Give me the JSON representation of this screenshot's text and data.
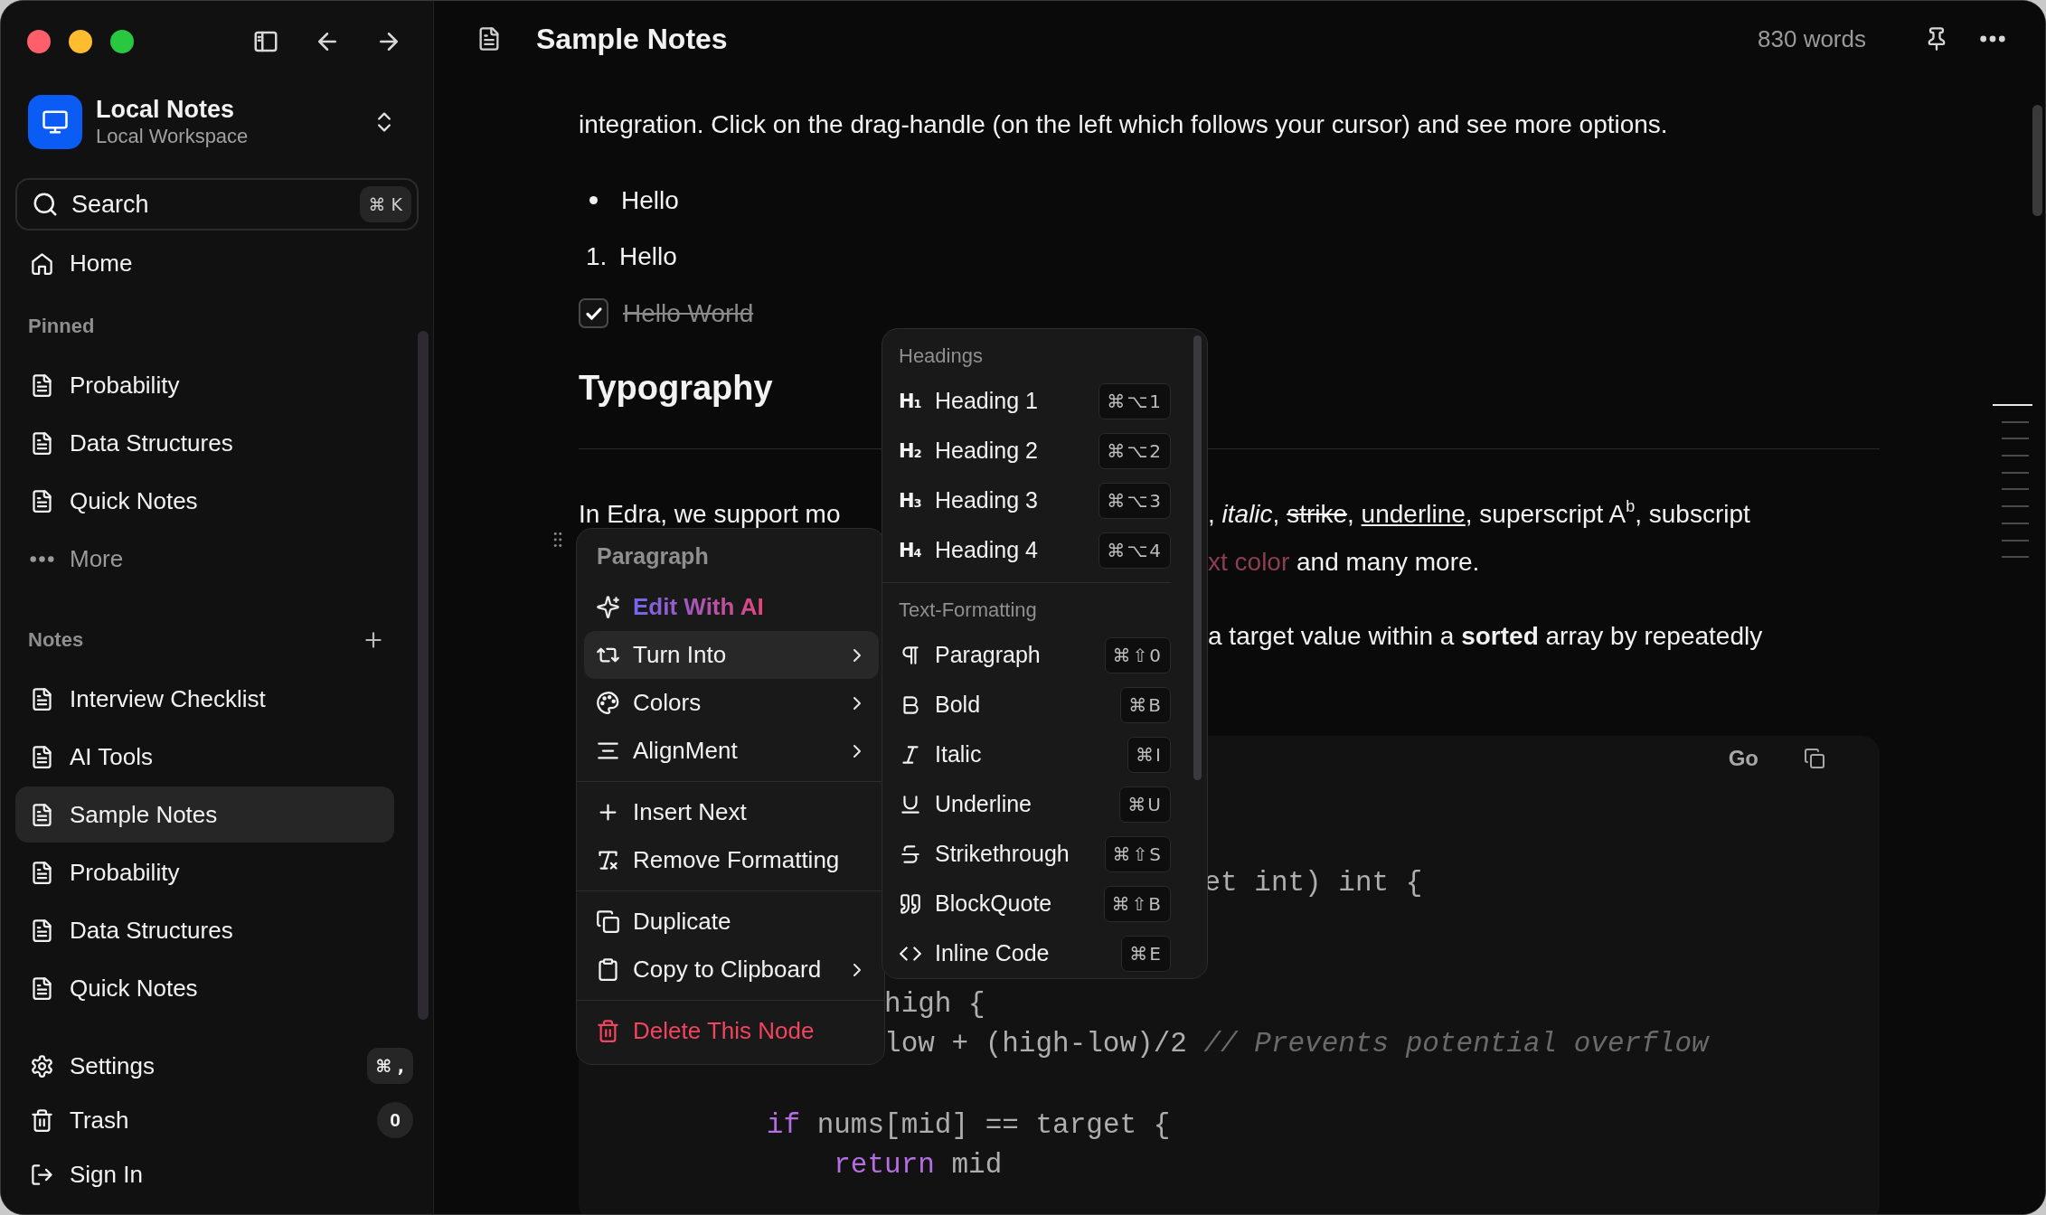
{
  "window": {
    "title": "Sample Notes",
    "word_count": "830 words"
  },
  "sidebar": {
    "workspace": {
      "name": "Local Notes",
      "subtitle": "Local Workspace"
    },
    "search": {
      "label": "Search",
      "shortcut": "⌘ K"
    },
    "home": "Home",
    "pinned": {
      "title": "Pinned",
      "more": "More",
      "items": [
        {
          "label": "Probability",
          "selected": false
        },
        {
          "label": "Data Structures",
          "selected": false
        },
        {
          "label": "Quick Notes",
          "selected": false
        }
      ]
    },
    "notes": {
      "title": "Notes",
      "items": [
        {
          "label": "Interview Checklist",
          "selected": false
        },
        {
          "label": "AI Tools",
          "selected": false
        },
        {
          "label": "Sample Notes",
          "selected": true
        },
        {
          "label": "Probability",
          "selected": false
        },
        {
          "label": "Data Structures",
          "selected": false
        },
        {
          "label": "Quick Notes",
          "selected": false
        }
      ]
    },
    "footer": [
      {
        "kind": "settings",
        "label": "Settings",
        "badge": "⌘ ,"
      },
      {
        "kind": "trash",
        "label": "Trash",
        "badge": "0"
      },
      {
        "kind": "sign_in",
        "label": "Sign In"
      }
    ]
  },
  "document": {
    "intro": [
      "integration. Click on the drag-handle (on the left which follows your cursor) and see more options."
    ],
    "bullet_item": "Hello",
    "numbered_item": {
      "marker": "1.",
      "label": "Hello"
    },
    "task": {
      "label": "Hello World",
      "checked": true
    },
    "heading": "Typography",
    "paragraph_lines": [
      {
        "left": "In Edra, we support mo",
        "right": [
          {
            "kind": "plain",
            "text": ", "
          },
          {
            "kind": "italic",
            "text": "italic"
          },
          {
            "kind": "plain",
            "text": ", "
          },
          {
            "kind": "strike",
            "text": "strike"
          },
          {
            "kind": "plain",
            "text": ", "
          },
          {
            "kind": "underline",
            "text": "underline"
          },
          {
            "kind": "plain",
            "text": ", superscript A"
          },
          {
            "kind": "sup",
            "text": "b"
          },
          {
            "kind": "plain",
            "text": ", subscript"
          }
        ]
      },
      {
        "right": [
          {
            "kind": "text_color",
            "text": "xt color"
          },
          {
            "kind": "plain",
            "text": " and many more."
          }
        ]
      },
      {
        "right": [
          {
            "kind": "plain",
            "text": "a target value within a "
          },
          {
            "kind": "bold",
            "text": "sorted"
          },
          {
            "kind": "plain",
            "text": " array by repeatedly"
          }
        ]
      }
    ],
    "code_block": {
      "language": "Go",
      "lines": [
        [
          {
            "kind": "plain",
            "text": "et int) int {"
          }
        ],
        [
          {
            "kind": "plain",
            "text": "high {"
          }
        ],
        [
          {
            "kind": "plain",
            "text": "low + (high-low)/2 "
          },
          {
            "kind": "comment",
            "text": "// Prevents potential overflow"
          }
        ],
        [
          {
            "kind": "keyword",
            "text": "if"
          },
          {
            "kind": "plain",
            "text": " nums[mid] == target {"
          }
        ],
        [
          {
            "kind": "keyword",
            "text": "return"
          },
          {
            "kind": "plain",
            "text": " mid"
          }
        ]
      ]
    }
  },
  "block_menu": {
    "title": "Paragraph",
    "groups": [
      [
        {
          "label": "Edit With AI",
          "kind": "ai",
          "selected": false,
          "submenu": false
        },
        {
          "label": "Turn Into",
          "kind": "normal",
          "selected": true,
          "submenu": true
        },
        {
          "label": "Colors",
          "kind": "normal",
          "selected": false,
          "submenu": true
        },
        {
          "label": "AlignMent",
          "kind": "normal",
          "selected": false,
          "submenu": true
        }
      ],
      [
        {
          "label": "Insert Next",
          "kind": "normal",
          "selected": false,
          "submenu": false
        },
        {
          "label": "Remove Formatting",
          "kind": "normal",
          "selected": false,
          "submenu": false
        }
      ],
      [
        {
          "label": "Duplicate",
          "kind": "normal",
          "selected": false,
          "submenu": false
        },
        {
          "label": "Copy to Clipboard",
          "kind": "normal",
          "selected": false,
          "submenu": true
        }
      ],
      [
        {
          "label": "Delete This Node",
          "kind": "danger",
          "selected": false,
          "submenu": false
        }
      ]
    ]
  },
  "turn_into_menu": {
    "sections": [
      {
        "title": "Headings",
        "items": [
          {
            "glyph": "H₁",
            "label": "Heading 1",
            "shortcut": "⌘⌥1"
          },
          {
            "glyph": "H₂",
            "label": "Heading 2",
            "shortcut": "⌘⌥2"
          },
          {
            "glyph": "H₃",
            "label": "Heading 3",
            "shortcut": "⌘⌥3"
          },
          {
            "glyph": "H₄",
            "label": "Heading 4",
            "shortcut": "⌘⌥4"
          }
        ]
      },
      {
        "title": "Text-Formatting",
        "items": [
          {
            "label": "Paragraph",
            "shortcut": "⌘⇧0"
          },
          {
            "label": "Bold",
            "shortcut": "⌘B"
          },
          {
            "label": "Italic",
            "shortcut": "⌘I"
          },
          {
            "label": "Underline",
            "shortcut": "⌘U"
          },
          {
            "label": "Strikethrough",
            "shortcut": "⌘⇧S"
          },
          {
            "label": "BlockQuote",
            "shortcut": "⌘⇧B"
          },
          {
            "label": "Inline Code",
            "shortcut": "⌘E"
          }
        ]
      }
    ]
  }
}
